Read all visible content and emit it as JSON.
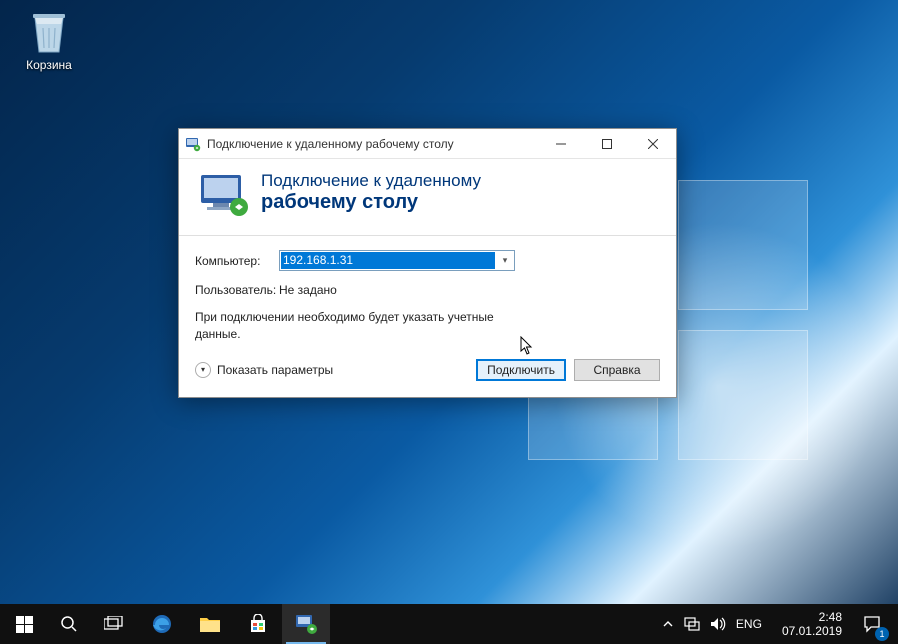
{
  "desktop": {
    "recycle_bin_label": "Корзина"
  },
  "rdp": {
    "title": "Подключение к удаленному рабочему столу",
    "heading_line1": "Подключение к удаленному",
    "heading_line2": "рабочему столу",
    "computer_label": "Компьютер:",
    "computer_value": "192.168.1.31",
    "user_label": "Пользователь:",
    "user_value": "Не задано",
    "hint": "При подключении необходимо будет указать учетные данные.",
    "show_options": "Показать параметры",
    "connect_btn": "Подключить",
    "help_btn": "Справка"
  },
  "taskbar": {
    "lang": "ENG",
    "time": "2:48",
    "date": "07.01.2019",
    "notif_count": "1"
  }
}
